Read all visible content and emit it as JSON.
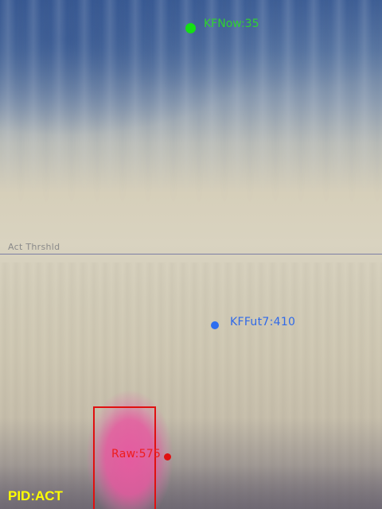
{
  "overlay": {
    "threshold_label": "Act Thrshld",
    "markers": {
      "kf_now": {
        "label": "KFNow:35",
        "color": "#14e014"
      },
      "kf_future": {
        "label": "KFFut7:410",
        "color": "#2d6ef0"
      },
      "raw": {
        "label": "Raw:575",
        "color": "#e01010"
      }
    },
    "status": {
      "text": "PID:ACT",
      "color": "#ffff00"
    }
  }
}
